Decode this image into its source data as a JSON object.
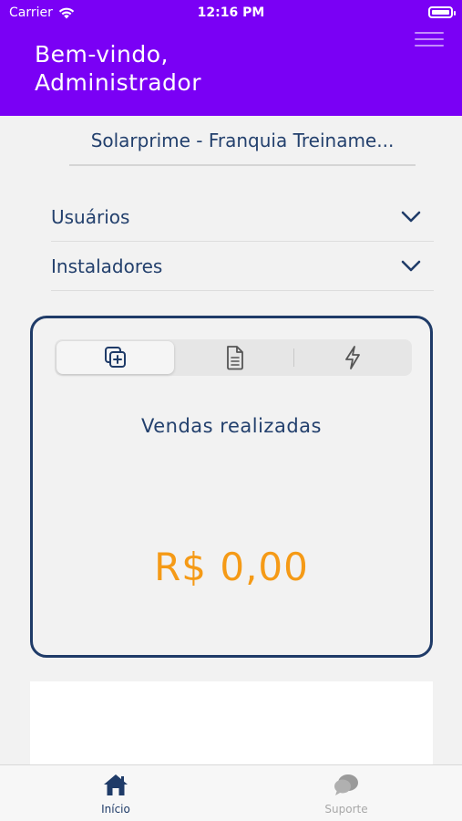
{
  "status_bar": {
    "carrier": "Carrier",
    "time": "12:16 PM"
  },
  "header": {
    "welcome_line1": "Bem-vindo,",
    "welcome_line2": "Administrador",
    "menu_icon": "hamburger-icon",
    "background_color": "#7a00f5"
  },
  "company_selector": {
    "value": "Solarprime - Franquia Treiname..."
  },
  "accordions": [
    {
      "label": "Usuários",
      "icon": "chevron-down-icon"
    },
    {
      "label": "Instaladores",
      "icon": "chevron-down-icon"
    }
  ],
  "sales_card": {
    "segments": [
      {
        "icon": "add-documents-icon",
        "active": true
      },
      {
        "icon": "document-icon",
        "active": false
      },
      {
        "icon": "lightning-icon",
        "active": false
      }
    ],
    "title": "Vendas realizadas",
    "value": "R$ 0,00",
    "value_color": "#f59a16",
    "border_color": "#1f3b68"
  },
  "tab_bar": {
    "items": [
      {
        "label": "Início",
        "icon": "home-icon",
        "active": true
      },
      {
        "label": "Suporte",
        "icon": "chat-bubbles-icon",
        "active": false
      }
    ]
  }
}
